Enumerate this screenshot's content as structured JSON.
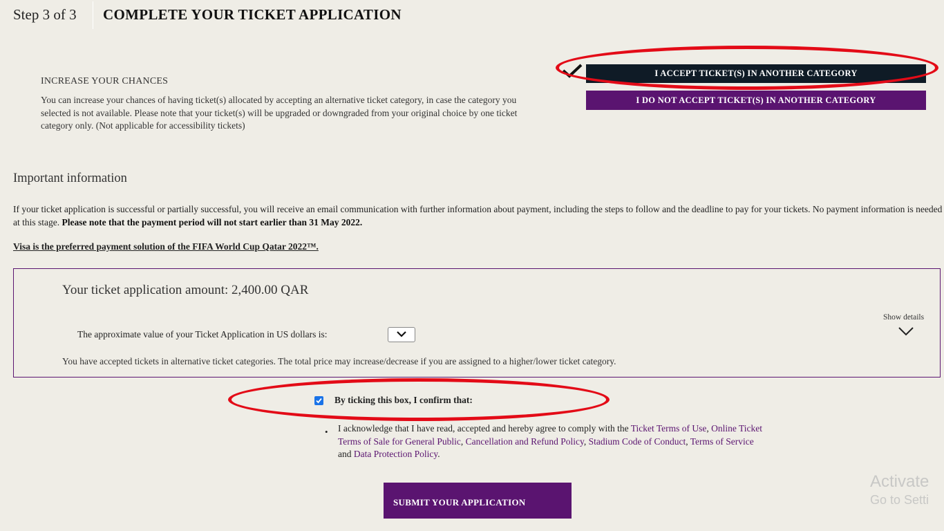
{
  "header": {
    "step": "Step 3 of 3",
    "title": "COMPLETE YOUR TICKET APPLICATION"
  },
  "chances": {
    "heading": "INCREASE YOUR CHANCES",
    "text": "You can increase your chances of having ticket(s) allocated by accepting an alternative ticket category, in case the category you selected is not available. Please note that your ticket(s) will be upgraded or downgraded from your original choice by one ticket category only. (Not applicable for accessibility tickets)",
    "accept_label": "I ACCEPT TICKET(S) IN ANOTHER CATEGORY",
    "decline_label": "I DO NOT ACCEPT TICKET(S) IN ANOTHER CATEGORY",
    "accept_selected": true
  },
  "important": {
    "heading": "Important information",
    "text": "If your ticket application is successful or partially successful, you will receive an email communication with further information about payment, including the steps to follow and the deadline to pay for your tickets. No payment information is needed at this stage.",
    "bold_note": "Please note that the payment period will not start earlier than 31 May 2022.",
    "visa_link": "Visa is the preferred payment solution of the FIFA World Cup Qatar 2022™."
  },
  "amount": {
    "line": "Your ticket application amount: 2,400.00 QAR",
    "usd_label": "The approximate value of your Ticket Application in US dollars is:",
    "show_details": "Show details",
    "accepted_note": "You have accepted tickets in alternative ticket categories. The total price may increase/decrease if you are assigned to a higher/lower ticket category."
  },
  "confirm": {
    "checked": true,
    "label": "By ticking this box, I confirm that:",
    "ack_prefix": "I acknowledge that I have read, accepted and hereby agree to comply with the",
    "link_ticket_terms": "Ticket Terms of Use",
    "link_online_terms": "Online Ticket Terms of Sale for General Public",
    "link_cancellation": "Cancellation and Refund Policy",
    "link_stadium": "Stadium Code of Conduct",
    "link_service": "Terms of Service",
    "and_word": "and",
    "link_data": "Data Protection Policy"
  },
  "submit_label": "SUBMIT YOUR APPLICATION",
  "watermark": {
    "line1": "Activate",
    "line2": "Go to Setti"
  },
  "colors": {
    "accent_purple": "#5a1470",
    "dark_navy": "#0f1b26",
    "annotation_red": "#e30b17",
    "background": "#efede6"
  }
}
